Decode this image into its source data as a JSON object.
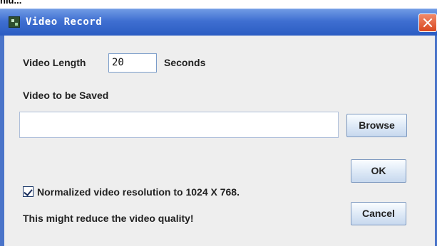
{
  "top_fragment": "nlu...",
  "window": {
    "title": "Video Record"
  },
  "form": {
    "length_label": "Video Length",
    "length_value": "20",
    "seconds_label": "Seconds",
    "save_label": "Video to be Saved",
    "save_path": "",
    "browse_label": "Browse",
    "ok_label": "OK",
    "normalize_checked": true,
    "normalize_label": "Normalized video resolution to 1024 X 768.",
    "warning_label": "This might reduce the video quality!",
    "cancel_label": "Cancel"
  },
  "colors": {
    "titlebar": "#2b5cc2",
    "close_button": "#d9471f",
    "window_bg": "#eeeeee"
  },
  "icons": {
    "app": "app-icon",
    "close": "close-icon",
    "checkbox": "checkbox-checked-icon"
  }
}
